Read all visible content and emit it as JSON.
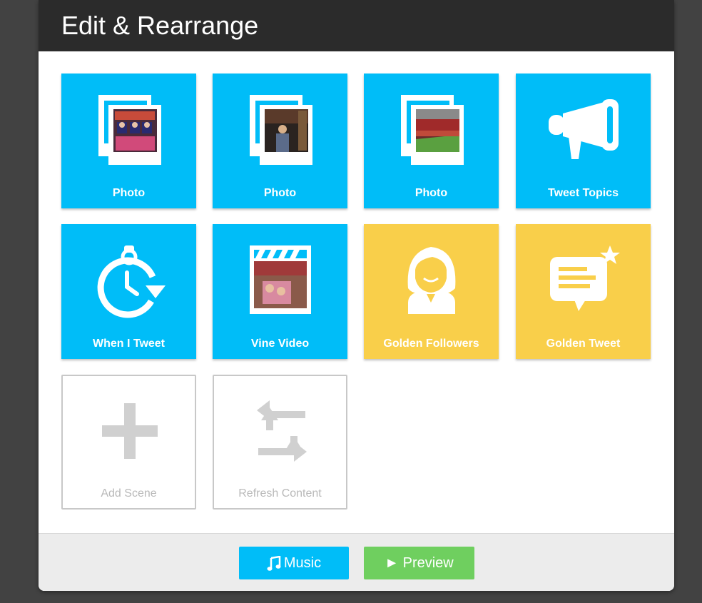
{
  "header": {
    "title": "Edit & Rearrange"
  },
  "tiles": [
    {
      "label": "Photo"
    },
    {
      "label": "Photo"
    },
    {
      "label": "Photo"
    },
    {
      "label": "Tweet Topics"
    },
    {
      "label": "When I Tweet"
    },
    {
      "label": "Vine Video"
    },
    {
      "label": "Golden Followers"
    },
    {
      "label": "Golden Tweet"
    },
    {
      "label": "Add Scene"
    },
    {
      "label": "Refresh Content"
    }
  ],
  "footer": {
    "music_label": "Music",
    "preview_label": "► Preview"
  },
  "colors": {
    "blue": "#00bdf8",
    "yellow": "#f9cf4a",
    "green": "#6fcf5f",
    "header": "#2b2b2b"
  }
}
